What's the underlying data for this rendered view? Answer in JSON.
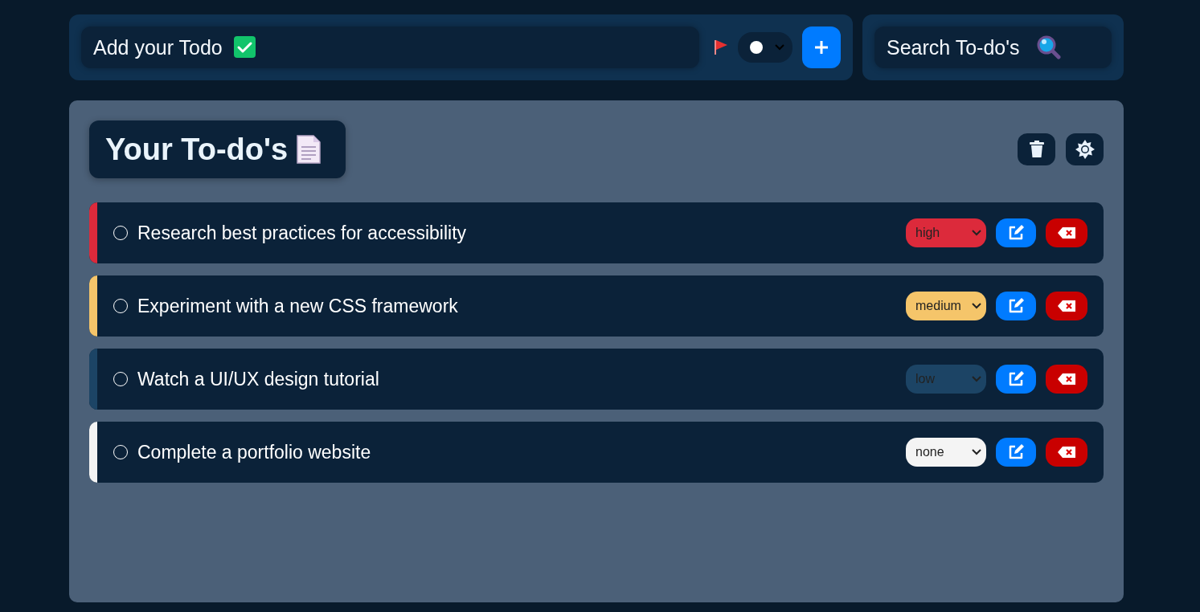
{
  "add_form": {
    "placeholder": "Add your Todo"
  },
  "search": {
    "placeholder": "Search To-do's"
  },
  "list": {
    "title": "Your To-do's"
  },
  "todos": [
    {
      "text": "Research best practices for accessibility",
      "checked": false,
      "priority": "high",
      "color": "#dc2a3b"
    },
    {
      "text": "Experiment with a new CSS framework",
      "checked": false,
      "priority": "medium",
      "color": "#f5c56a"
    },
    {
      "text": "Watch a UI/UX design tutorial",
      "checked": false,
      "priority": "low",
      "color": "#1c4465"
    },
    {
      "text": "Complete a portfolio website",
      "checked": false,
      "priority": "none",
      "color": "#f4f4f4"
    }
  ]
}
